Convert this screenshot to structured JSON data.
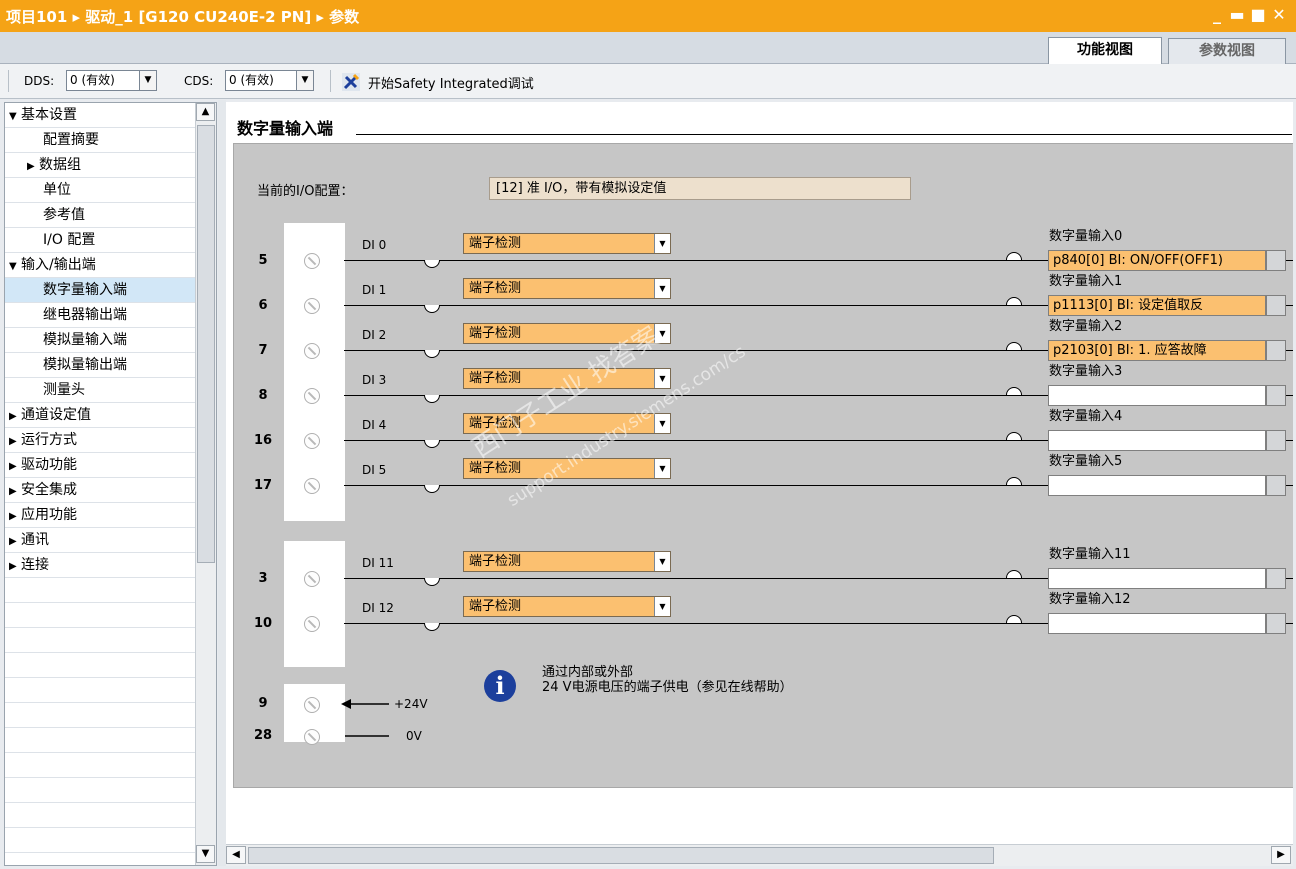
{
  "window": {
    "title": "项目101 ▸ 驱动_1 [G120 CU240E-2 PN] ▸ 参数",
    "controls": [
      "_",
      "▬",
      "■",
      "✕"
    ]
  },
  "view_tabs": {
    "function_view": "功能视图",
    "parameter_view": "参数视图",
    "active": "function_view"
  },
  "toolbar": {
    "dds_label": "DDS:",
    "dds_value": "0 (有效)",
    "cds_label": "CDS:",
    "cds_value": "0 (有效)",
    "safety_label": "开始Safety Integrated调试"
  },
  "nav": {
    "items": [
      {
        "label": "基本设置",
        "expander": "▼"
      },
      {
        "label": "配置摘要",
        "expander": ""
      },
      {
        "label": "数据组",
        "expander": "▶"
      },
      {
        "label": "单位",
        "expander": ""
      },
      {
        "label": "参考值",
        "expander": ""
      },
      {
        "label": "I/O 配置",
        "expander": ""
      },
      {
        "label": "输入/输出端",
        "expander": "▼"
      },
      {
        "label": "数字量输入端",
        "expander": "",
        "selected": true
      },
      {
        "label": "继电器输出端",
        "expander": ""
      },
      {
        "label": "模拟量输入端",
        "expander": ""
      },
      {
        "label": "模拟量输出端",
        "expander": ""
      },
      {
        "label": "测量头",
        "expander": ""
      },
      {
        "label": "通道设定值",
        "expander": "▶"
      },
      {
        "label": "运行方式",
        "expander": "▶"
      },
      {
        "label": "驱动功能",
        "expander": "▶"
      },
      {
        "label": "安全集成",
        "expander": "▶"
      },
      {
        "label": "应用功能",
        "expander": "▶"
      },
      {
        "label": "通讯",
        "expander": "▶"
      },
      {
        "label": "连接",
        "expander": "▶"
      }
    ]
  },
  "main": {
    "section_title": "数字量输入端",
    "io_config_label": "当前的I/O配置：",
    "io_config_value": "[12] 准 I/O，带有模拟设定值",
    "inputs": [
      {
        "terminal": "5",
        "di": "DI 0",
        "mode": "端子检测",
        "name": "数字量输入0",
        "param": "p840[0] BI: ON/OFF(OFF1)"
      },
      {
        "terminal": "6",
        "di": "DI 1",
        "mode": "端子检测",
        "name": "数字量输入1",
        "param": "p1113[0] BI: 设定值取反"
      },
      {
        "terminal": "7",
        "di": "DI 2",
        "mode": "端子检测",
        "name": "数字量输入2",
        "param": "p2103[0] BI: 1. 应答故障"
      },
      {
        "terminal": "8",
        "di": "DI 3",
        "mode": "端子检测",
        "name": "数字量输入3",
        "param": ""
      },
      {
        "terminal": "16",
        "di": "DI 4",
        "mode": "端子检测",
        "name": "数字量输入4",
        "param": ""
      },
      {
        "terminal": "17",
        "di": "DI 5",
        "mode": "端子检测",
        "name": "数字量输入5",
        "param": ""
      },
      {
        "terminal": "3",
        "di": "DI 11",
        "mode": "端子检测",
        "name": "数字量输入11",
        "param": ""
      },
      {
        "terminal": "10",
        "di": "DI 12",
        "mode": "端子检测",
        "name": "数字量输入12",
        "param": ""
      }
    ],
    "supply": {
      "terminal_24v": "9",
      "terminal_0v": "28",
      "label_24v": "+24V",
      "label_0v": "0V",
      "info_line1": "通过内部或外部",
      "info_line2": "24 V电源电压的端子供电（参见在线帮助）"
    },
    "watermark_line1": "西门子工业 找答案",
    "watermark_line2": "support.industry.siemens.com/cs"
  },
  "colors": {
    "title_bar": "#f5a316",
    "param_set": "#fbc070",
    "info_icon": "#1c3f9c"
  }
}
